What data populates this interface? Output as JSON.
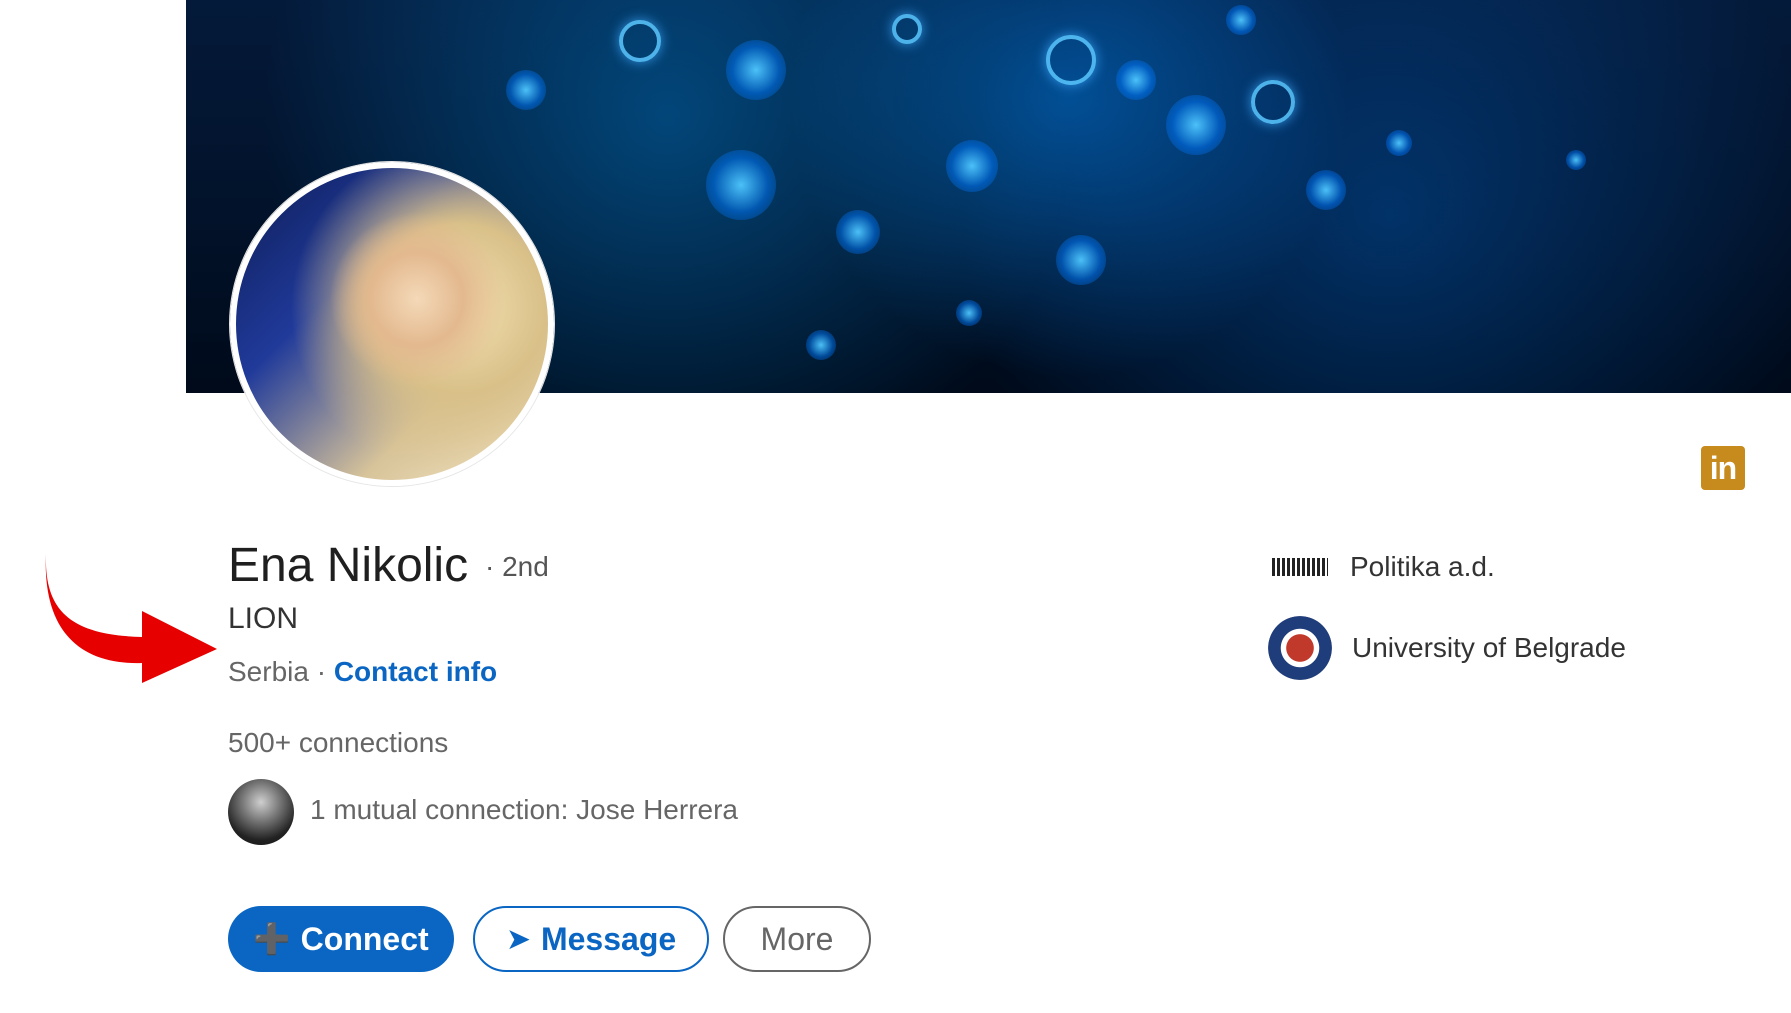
{
  "profile": {
    "name": "Ena Nikolic",
    "degree": "· 2nd",
    "headline": "LION",
    "location": "Serbia ·",
    "contact_info": "Contact info",
    "connections": "500+ connections",
    "mutual": "1 mutual connection: Jose Herrera"
  },
  "actions": {
    "connect": "Connect",
    "message": "Message",
    "more": "More"
  },
  "organizations": [
    {
      "name": "Politika a.d.",
      "logo": "politika-logo"
    },
    {
      "name": "University of Belgrade",
      "logo": "university-seal"
    }
  ],
  "icons": {
    "linkedin": "linkedin-icon",
    "arrow": "red-arrow-annotation"
  },
  "colors": {
    "primary": "#0a66c2",
    "linkedin_badge": "#c78a1d",
    "annotation": "#e60000"
  }
}
